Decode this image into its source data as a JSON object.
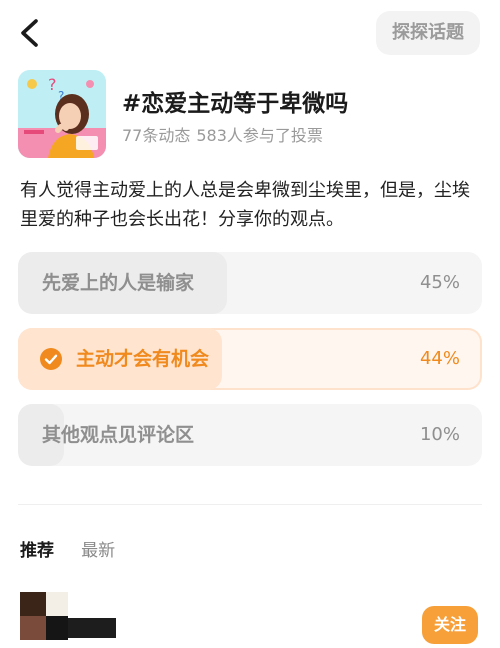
{
  "header": {
    "back_icon": "chevron-left-icon",
    "explore_label": "探探话题"
  },
  "topic": {
    "title": "#恋爱主动等于卑微吗",
    "posts_count": "77条动态",
    "vote_count": "583人参与了投票",
    "description": "有人觉得主动爱上的人总是会卑微到尘埃里，但是，尘埃里爱的种子也会长出花！分享你的观点。"
  },
  "poll": {
    "options": [
      {
        "label": "先爱上的人是输家",
        "percent_text": "45%",
        "share": 0.45,
        "selected": false
      },
      {
        "label": "主动才会有机会",
        "percent_text": "44%",
        "share": 0.44,
        "selected": true
      },
      {
        "label": "其他观点见评论区",
        "percent_text": "10%",
        "share": 0.1,
        "selected": false
      }
    ],
    "accent_color": "#f08a1e"
  },
  "feed": {
    "tabs": [
      "推荐",
      "最新"
    ],
    "active_tab": "推荐",
    "follow_label": "关注",
    "follow_color": "#f7a03a"
  }
}
